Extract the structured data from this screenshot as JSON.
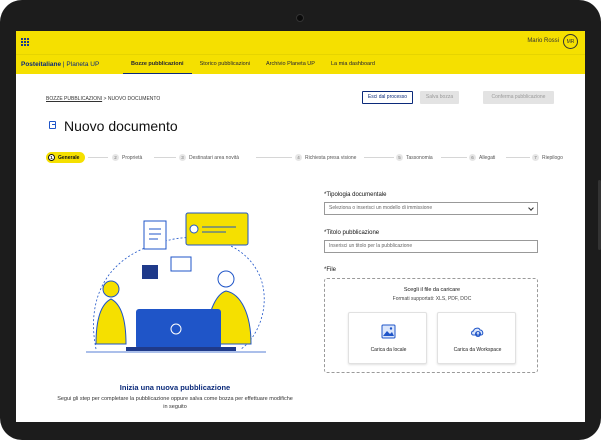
{
  "topbar": {
    "user_name": "Mario Rossi",
    "user_initials": "MR"
  },
  "brand": {
    "name": "Posteitaliane",
    "product": "Planeta UP"
  },
  "nav": [
    {
      "label": "Bozze pubblicazioni",
      "active": true
    },
    {
      "label": "Storico pubblicazioni",
      "active": false
    },
    {
      "label": "Archivio Planeta UP",
      "active": false
    },
    {
      "label": "La mia dashboard",
      "active": false
    }
  ],
  "breadcrumb": {
    "parent": "BOZZE PUBBLICAZIONI",
    "separator": ">",
    "current": "NUOVO DOCUMENTO"
  },
  "actions": {
    "exit_label": "Esci dal processo",
    "save_label": "Salva bozza",
    "confirm_label": "Conferma pubblicazione"
  },
  "page_title": "Nuovo documento",
  "steps": [
    {
      "num": "1",
      "label": "Generale",
      "active": true
    },
    {
      "num": "2",
      "label": "Proprietà",
      "active": false
    },
    {
      "num": "3",
      "label": "Destinatari area novità",
      "active": false
    },
    {
      "num": "4",
      "label": "Richiesta presa visione",
      "active": false
    },
    {
      "num": "5",
      "label": "Tassonomia",
      "active": false
    },
    {
      "num": "6",
      "label": "Allegati",
      "active": false
    },
    {
      "num": "7",
      "label": "Riepilogo",
      "active": false
    }
  ],
  "empty_state": {
    "title": "Inizia una nuova pubblicazione",
    "description": "Segui gli step per completare la pubblicazione oppure salva come bozza per effettuare modifiche in seguito"
  },
  "form": {
    "tipologia_label": "*Tipologia documentale",
    "tipologia_placeholder": "Seleziona o inserisci un modello di immissione",
    "titolo_label": "*Titolo pubblicazione",
    "titolo_placeholder": "Inserisci un titolo per la pubblicazione",
    "file_label": "*File",
    "dropzone_title": "Scegli il file da caricare",
    "dropzone_formats": "Formati supportati: XLS, PDF, DOC",
    "upload_local_label": "Carica da locale",
    "upload_workspace_label": "Carica da Workspace"
  },
  "colors": {
    "brand_yellow": "#f5e000",
    "brand_blue": "#0b2a7a",
    "accent_blue": "#1f55c8"
  }
}
